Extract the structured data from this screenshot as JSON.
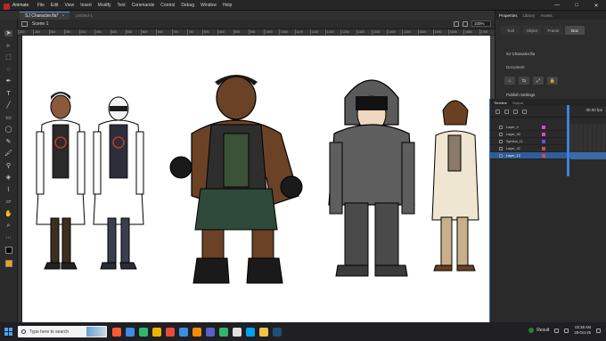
{
  "app": {
    "name": "Animate",
    "menus": [
      "File",
      "Edit",
      "View",
      "Insert",
      "Modify",
      "Text",
      "Commands",
      "Control",
      "Debug",
      "Window",
      "Help"
    ],
    "window_controls": [
      "—",
      "□",
      "✕"
    ]
  },
  "tabs": {
    "active": "SJ Character.fla*",
    "inactive": "Untitled-1"
  },
  "scene": {
    "name": "Scene 1",
    "zoom": "100%"
  },
  "ruler": {
    "labels": [
      "200",
      "250",
      "300",
      "350",
      "400",
      "450",
      "500",
      "550",
      "600",
      "650",
      "700",
      "750",
      "800",
      "850",
      "900",
      "950",
      "1000",
      "1050",
      "1100",
      "1150",
      "1200",
      "1250",
      "1300",
      "1350",
      "1400",
      "1450",
      "1500",
      "1550",
      "1600",
      "1650",
      "1700"
    ]
  },
  "properties": {
    "tabs": [
      "Properties",
      "Library",
      "Assets"
    ],
    "segments": [
      "Tool",
      "Object",
      "Frame",
      "Doc"
    ],
    "document_name": "SJ Character.fla",
    "document_label": "Document",
    "publish_settings": "Publish Settings"
  },
  "timeline": {
    "tabs": [
      "Timeline",
      "Output"
    ],
    "frame_readout": "30.00 fps",
    "layers": [
      {
        "name": "Layer_4",
        "color": "#d84bd0"
      },
      {
        "name": "Layer_40",
        "color": "#d84bd0"
      },
      {
        "name": "Symbol_11",
        "color": "#7a4bd8"
      },
      {
        "name": "Layer_42",
        "color": "#d84b4b"
      },
      {
        "name": "Layer_12",
        "color": "#d84b4b",
        "selected": true
      }
    ]
  },
  "taskbar": {
    "search_placeholder": "Type here to search",
    "status": "Result",
    "time": "02:38 AM",
    "date": "28-Oct-25",
    "icon_colors": [
      "#ff5a36",
      "#3a8ee6",
      "#2fb86a",
      "#f0b400",
      "#e84c3d",
      "#3a8ee6",
      "#f28b00",
      "#5b5fc7",
      "#2fb86a",
      "#e1e1e1",
      "#00a2ed",
      "#f6c445",
      "#1f4e79"
    ]
  }
}
